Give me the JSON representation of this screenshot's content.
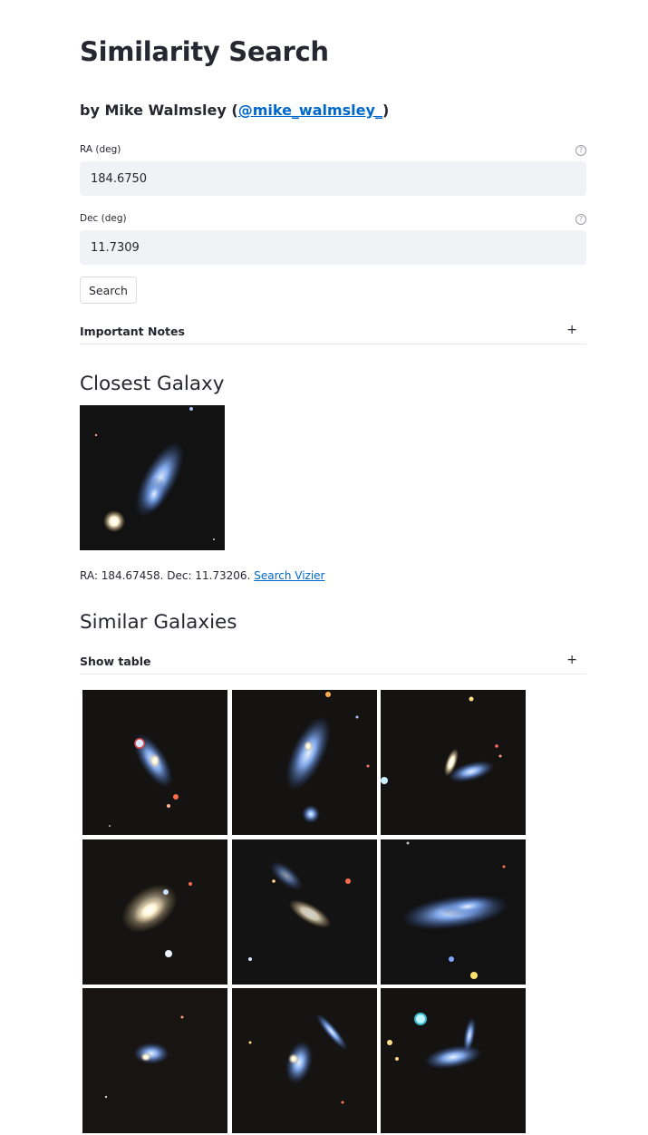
{
  "page": {
    "title": "Similarity Search"
  },
  "byline": {
    "prefix": "by Mike Walmsley (",
    "link": "@mike_walmsley_",
    "suffix": ")"
  },
  "ra": {
    "label": "RA (deg)",
    "value": "184.6750"
  },
  "dec": {
    "label": "Dec (deg)",
    "value": "11.7309"
  },
  "search_button": "Search",
  "notes_expander": {
    "label": "Important Notes",
    "toggle": "+"
  },
  "closest": {
    "heading": "Closest Galaxy",
    "coords_text": "RA: 184.67458. Dec: 11.73206.",
    "vizier_link": "Search Vizier"
  },
  "similar": {
    "heading": "Similar Galaxies",
    "table_expander": {
      "label": "Show table",
      "toggle": "+"
    },
    "thumb_count": 9
  },
  "colors": {
    "link": "#0068c9",
    "input_bg": "#f0f2f6",
    "sky": "#111111"
  }
}
